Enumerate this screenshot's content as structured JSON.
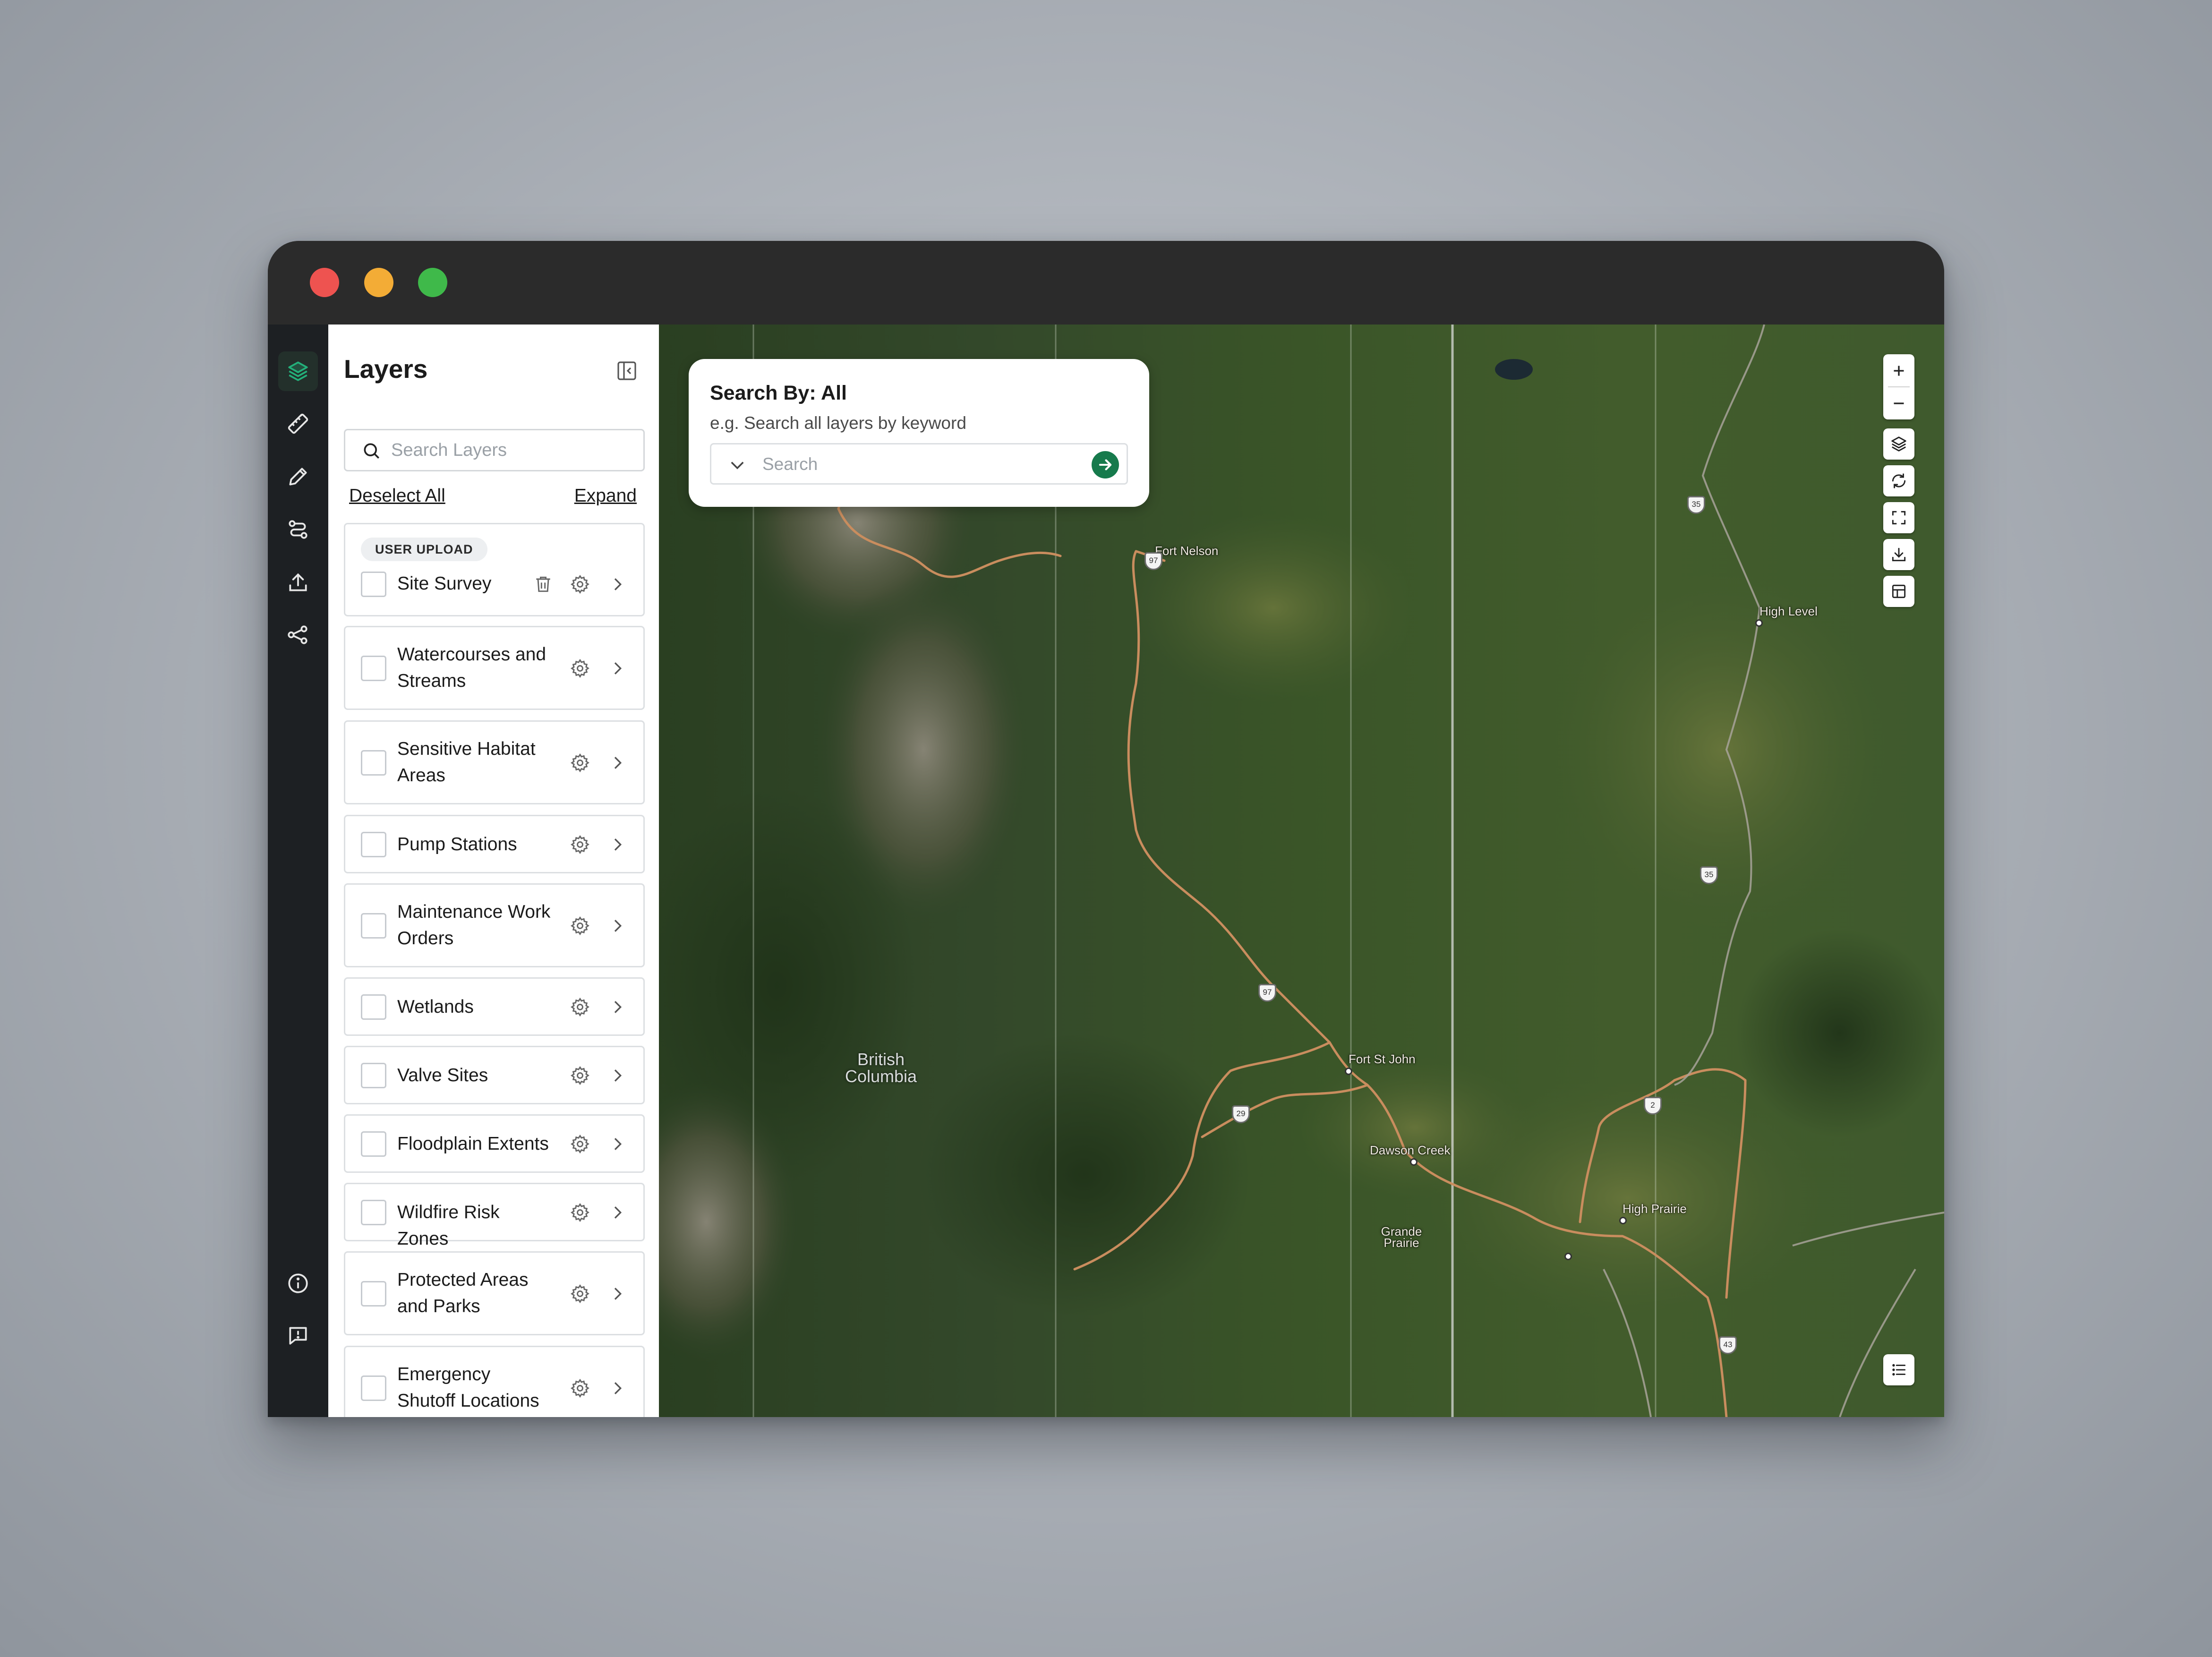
{
  "panel": {
    "title": "Layers",
    "search_placeholder": "Search Layers",
    "deselect_label": "Deselect All",
    "expand_label": "Expand"
  },
  "layers": [
    {
      "badge": "USER UPLOAD",
      "label": "Site Survey"
    },
    {
      "label": "Watercourses and Streams"
    },
    {
      "label": "Sensitive Habitat Areas"
    },
    {
      "label": "Pump Stations"
    },
    {
      "label": "Maintenance Work Orders"
    },
    {
      "label": "Wetlands"
    },
    {
      "label": "Valve Sites"
    },
    {
      "label": "Floodplain Extents"
    },
    {
      "label": "Wildfire Risk Zones"
    },
    {
      "label": "Protected Areas and Parks"
    },
    {
      "label": "Emergency Shutoff Locations"
    }
  ],
  "search_card": {
    "title": "Search By: All",
    "hint": "e.g. Search all layers by keyword",
    "placeholder": "Search"
  },
  "map": {
    "province": "British Columbia",
    "places": {
      "fort_nelson": "Fort Nelson",
      "high_level": "High Level",
      "fort_st_john": "Fort St John",
      "dawson_creek": "Dawson Creek",
      "grande_prairie": "Grande Prairie",
      "high_prairie": "High Prairie"
    },
    "shields": {
      "hwy97": "97",
      "hwy29": "29",
      "hwy2": "2",
      "hwy35_north": "35",
      "hwy35_south": "35",
      "hwy43": "43",
      "hwy97_north": "97"
    }
  },
  "colors": {
    "accent": "#167a4c",
    "rail": "#1d2023",
    "titlebar": "#2b2b2b"
  },
  "icons": {
    "rail": [
      "layers-icon",
      "ruler-icon",
      "pencil-icon",
      "route-icon",
      "upload-icon",
      "share-icon",
      "info-icon",
      "feedback-icon"
    ],
    "map_controls": [
      "zoom-in-icon",
      "zoom-out-icon",
      "basemap-icon",
      "refresh-icon",
      "fullscreen-icon",
      "download-icon",
      "table-icon",
      "legend-icon"
    ]
  }
}
